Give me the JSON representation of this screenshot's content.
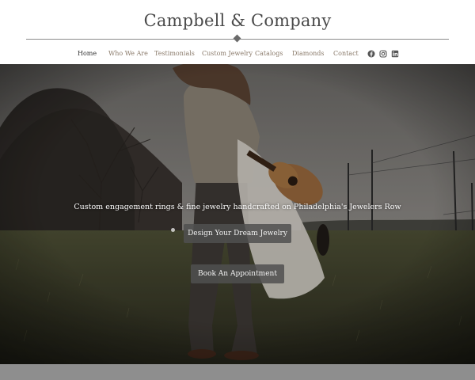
{
  "brand": {
    "name": "Campbell & Company"
  },
  "nav": {
    "items": [
      {
        "label": "Home",
        "active": true
      },
      {
        "label": "Who We Are",
        "active": false
      },
      {
        "label": "Testimonials",
        "active": false
      },
      {
        "label": "Custom Jewelry",
        "active": false
      },
      {
        "label": "Catalogs",
        "active": false
      },
      {
        "label": "Diamonds",
        "active": false
      },
      {
        "label": "Contact",
        "active": false
      }
    ],
    "social": [
      "facebook-icon",
      "instagram-icon",
      "linkedin-icon"
    ]
  },
  "hero": {
    "tagline": "Custom engagement rings & fine jewelry handcrafted on Philadelphia's Jewelers Row",
    "primary_button": "Design Your Dream Jewelry",
    "secondary_button": "Book An Appointment"
  },
  "colors": {
    "brand_text": "#4a4a4a",
    "nav_text": "#8a7a6a",
    "button_bg": "#505050",
    "footer_strip": "#8e8e8e"
  }
}
